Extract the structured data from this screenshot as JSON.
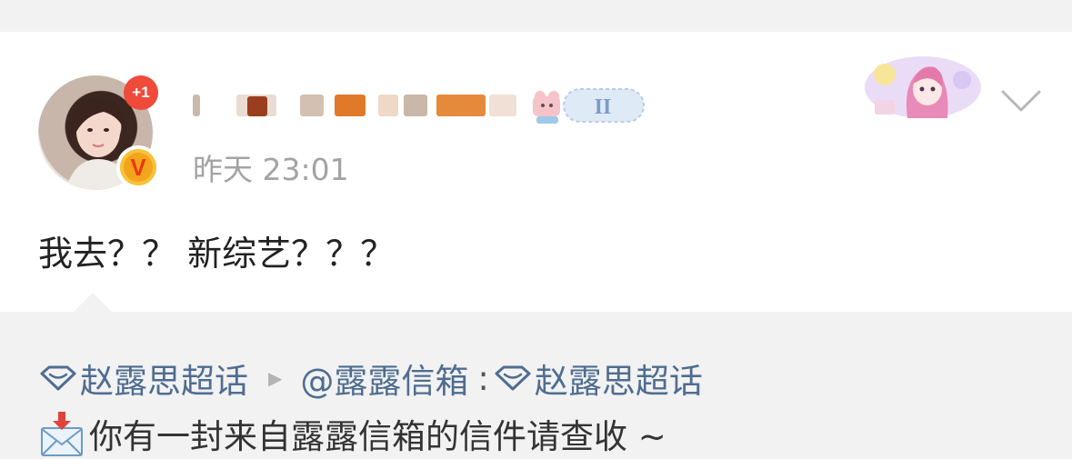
{
  "post": {
    "avatar_badge": "+1",
    "verified_mark": "V",
    "level_badge": "II",
    "timestamp": "昨天 23:01",
    "content": "我去？？ 新综艺？？？"
  },
  "quote": {
    "supertopic_label": "赵露思超话",
    "mention": "@露露信箱",
    "colon": ":",
    "supertopic_label_2": "赵露思超话",
    "message": "你有一封来自露露信箱的信件请查收 ~"
  },
  "colors": {
    "link": "#4f6d91",
    "timestamp": "#a3a3a3",
    "quote_bg": "#f2f2f2",
    "badge_red": "#ef4a3a"
  }
}
